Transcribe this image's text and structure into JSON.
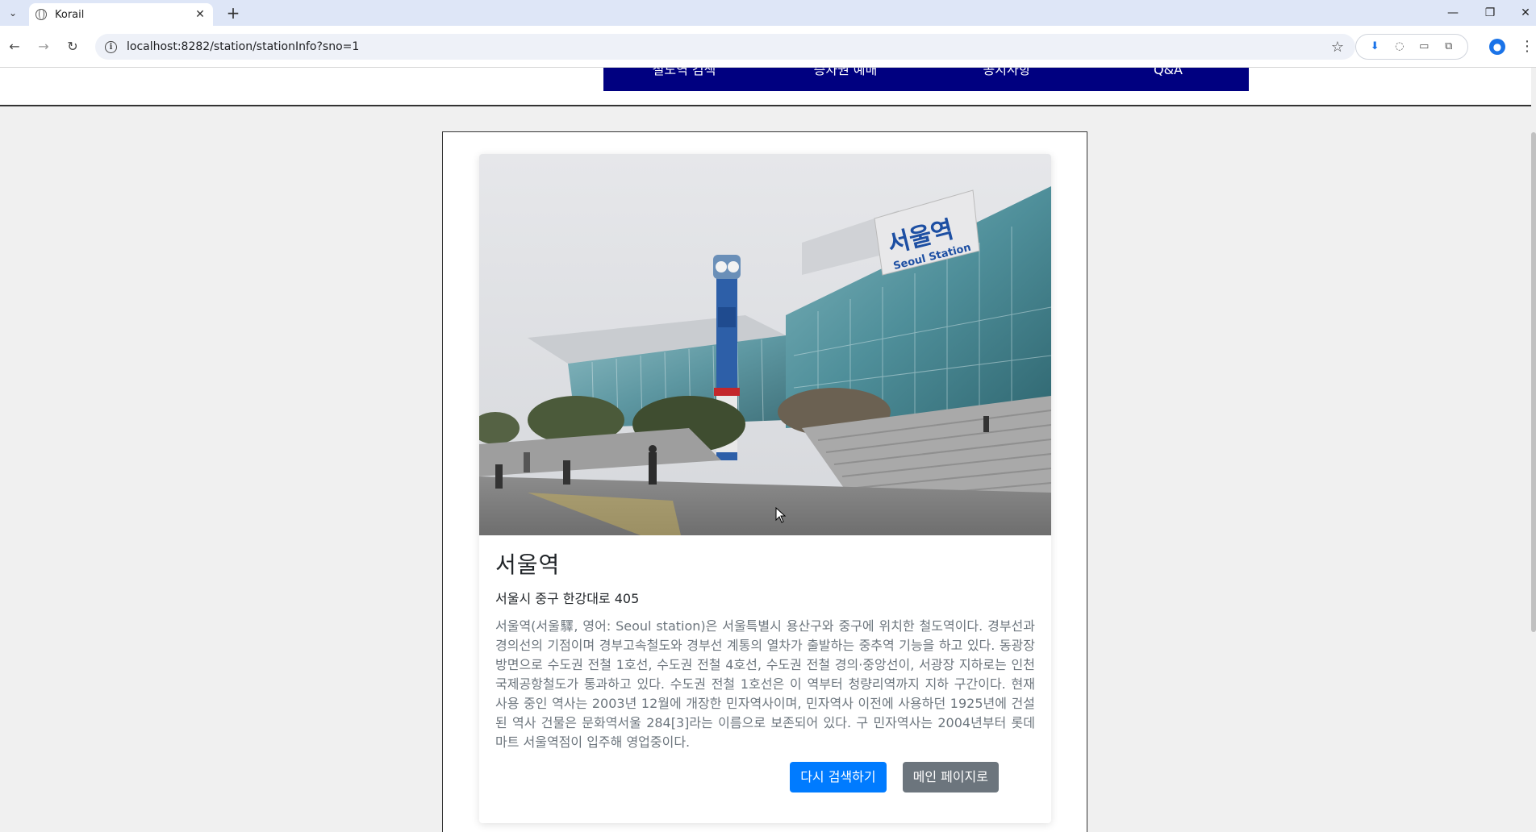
{
  "browser": {
    "tab_title": "Korail",
    "url": "localhost:8282/station/stationInfo?sno=1",
    "tab_close": "✕",
    "new_tab": "+",
    "win_minimize": "—",
    "win_restore": "❐",
    "win_close": "✕",
    "icons": {
      "back": "←",
      "forward": "→",
      "reload": "↻",
      "info": "i",
      "star": "☆",
      "menu": "⋮",
      "tab_search": "⌄"
    }
  },
  "nav": {
    "items": [
      "철도역 검색",
      "승차권 예매",
      "공지사항",
      "Q&A"
    ]
  },
  "station": {
    "name": "서울역",
    "address": "서울시 중구 한강대로 405",
    "description": "서울역(서울驛, 영어: Seoul station)은 서울특별시 용산구와 중구에 위치한 철도역이다. 경부선과 경의선의 기점이며 경부고속철도와 경부선 계통의 열차가 출발하는 중추역 기능을 하고 있다. 동광장 방면으로 수도권 전철 1호선, 수도권 전철 4호선, 수도권 전철 경의·중앙선이, 서광장 지하로는 인천국제공항철도가 통과하고 있다. 수도권 전철 1호선은 이 역부터 청량리역까지 지하 구간이다. 현재 사용 중인 역사는 2003년 12월에 개장한 민자역사이며, 민자역사 이전에 사용하던 1925년에 건설된 역사 건물은 문화역서울 284[3]라는 이름으로 보존되어 있다. 구 민자역사는 2004년부터 롯데마트 서울역점이 입주해 영업중이다.",
    "photo_sign_ko": "서울역",
    "photo_sign_en": "Seoul Station"
  },
  "buttons": {
    "search_again": "다시 검색하기",
    "main_page": "메인 페이지로"
  },
  "colors": {
    "nav_bg": "#000080",
    "primary": "#007bff",
    "secondary": "#6c757d"
  }
}
